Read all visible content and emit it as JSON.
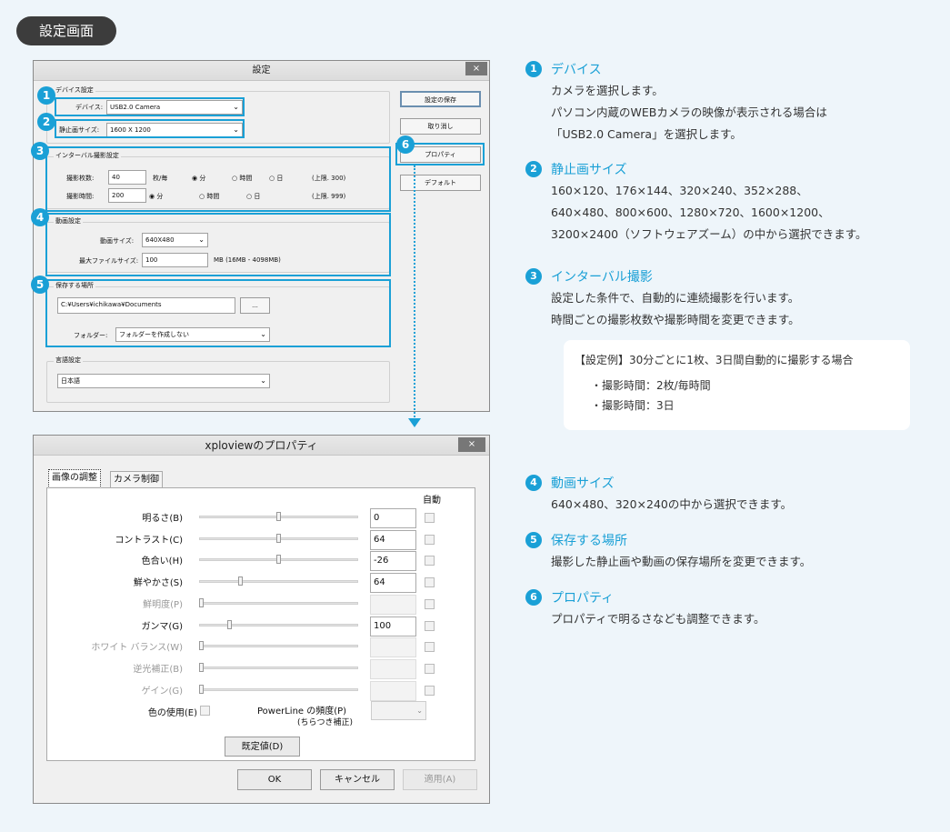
{
  "page_badge": "設定画面",
  "settings_dialog": {
    "title": "設定",
    "close": "×",
    "device_group": "デバイス設定",
    "device_label": "デバイス:",
    "device_value": "USB2.0 Camera",
    "still_label": "静止画サイズ:",
    "still_value": "1600 X 1200",
    "interval_group": "インターバル撮影設定",
    "shots_label": "撮影枚数:",
    "shots_value": "40",
    "shots_unit": "枚/毎",
    "shots_radio1": "◉ 分",
    "shots_radio2": "○ 時間",
    "shots_radio3": "○ 日",
    "shots_limit": "(上限. 300)",
    "time_label": "撮影時間:",
    "time_value": "200",
    "time_radio1": "◉ 分",
    "time_radio2": "○ 時間",
    "time_radio3": "○ 日",
    "time_limit": "(上限. 999)",
    "video_group": "動画設定",
    "video_size_label": "動画サイズ:",
    "video_size_value": "640X480",
    "max_file_label": "最大ファイルサイズ:",
    "max_file_value": "100",
    "max_file_unit": "MB (16MB - 4098MB)",
    "save_group": "保存する場所",
    "save_path": "C:¥Users¥ichikawa¥Documents",
    "browse": "...",
    "folder_label": "フォルダー:",
    "folder_value": "フォルダーを作成しない",
    "lang_group": "言語設定",
    "lang_value": "日本語",
    "btn_save": "設定の保存",
    "btn_cancel": "取り消し",
    "btn_property": "プロパティ",
    "btn_default": "デフォルト"
  },
  "callout_numbers": [
    "1",
    "2",
    "3",
    "4",
    "5",
    "6"
  ],
  "properties_dialog": {
    "title": "xploviewのプロパティ",
    "close": "×",
    "tab1": "画像の調整",
    "tab2": "カメラ制御",
    "auto_header": "自動",
    "rows": [
      {
        "label": "明るさ(B)",
        "value": "0",
        "enabled": true,
        "thumb": 0.5
      },
      {
        "label": "コントラスト(C)",
        "value": "64",
        "enabled": true,
        "thumb": 0.5
      },
      {
        "label": "色合い(H)",
        "value": "-26",
        "enabled": true,
        "thumb": 0.5
      },
      {
        "label": "鮮やかさ(S)",
        "value": "64",
        "enabled": true,
        "thumb": 0.25
      },
      {
        "label": "鮮明度(P)",
        "value": "",
        "enabled": false,
        "thumb": 0
      },
      {
        "label": "ガンマ(G)",
        "value": "100",
        "enabled": true,
        "thumb": 0.18
      },
      {
        "label": "ホワイト バランス(W)",
        "value": "",
        "enabled": false,
        "thumb": 0
      },
      {
        "label": "逆光補正(B)",
        "value": "",
        "enabled": false,
        "thumb": 0
      },
      {
        "label": "ゲイン(G)",
        "value": "",
        "enabled": false,
        "thumb": 0
      }
    ],
    "color_use": "色の使用(E)",
    "powerline_1": "PowerLine の頻度(P)",
    "powerline_2": "(ちらつき補正)",
    "btn_default": "既定値(D)",
    "btn_ok": "OK",
    "btn_cancel": "キャンセル",
    "btn_apply": "適用(A)"
  },
  "explanations": [
    {
      "num": "1",
      "heading": "デバイス",
      "lines": [
        "カメラを選択します。",
        "パソコン内蔵のWEBカメラの映像が表示される場合は",
        "「USB2.0 Camera」を選択します。"
      ]
    },
    {
      "num": "2",
      "heading": "静止画サイズ",
      "lines": [
        "160×120、176×144、320×240、352×288、",
        "640×480、800×600、1280×720、1600×1200、",
        "3200×2400（ソフトウェアズーム）の中から選択できます。"
      ]
    },
    {
      "num": "3",
      "heading": "インターバル撮影",
      "lines": [
        "設定した条件で、自動的に連続撮影を行います。",
        "時間ごとの撮影枚数や撮影時間を変更できます。"
      ]
    },
    {
      "num": "4",
      "heading": "動画サイズ",
      "lines": [
        "640×480、320×240の中から選択できます。"
      ]
    },
    {
      "num": "5",
      "heading": "保存する場所",
      "lines": [
        "撮影した静止画や動画の保存場所を変更できます。"
      ]
    },
    {
      "num": "6",
      "heading": "プロパティ",
      "lines": [
        "プロパティで明るさなども調整できます。"
      ]
    }
  ],
  "example": {
    "title": "【設定例】30分ごとに1枚、3日間自動的に撮影する場合",
    "items": [
      "・撮影時間：2枚/毎時間",
      "・撮影時間：3日"
    ]
  },
  "colors": {
    "accent": "#1aa0d6",
    "badge": "#3c3c3c",
    "background": "#eef5fa"
  }
}
